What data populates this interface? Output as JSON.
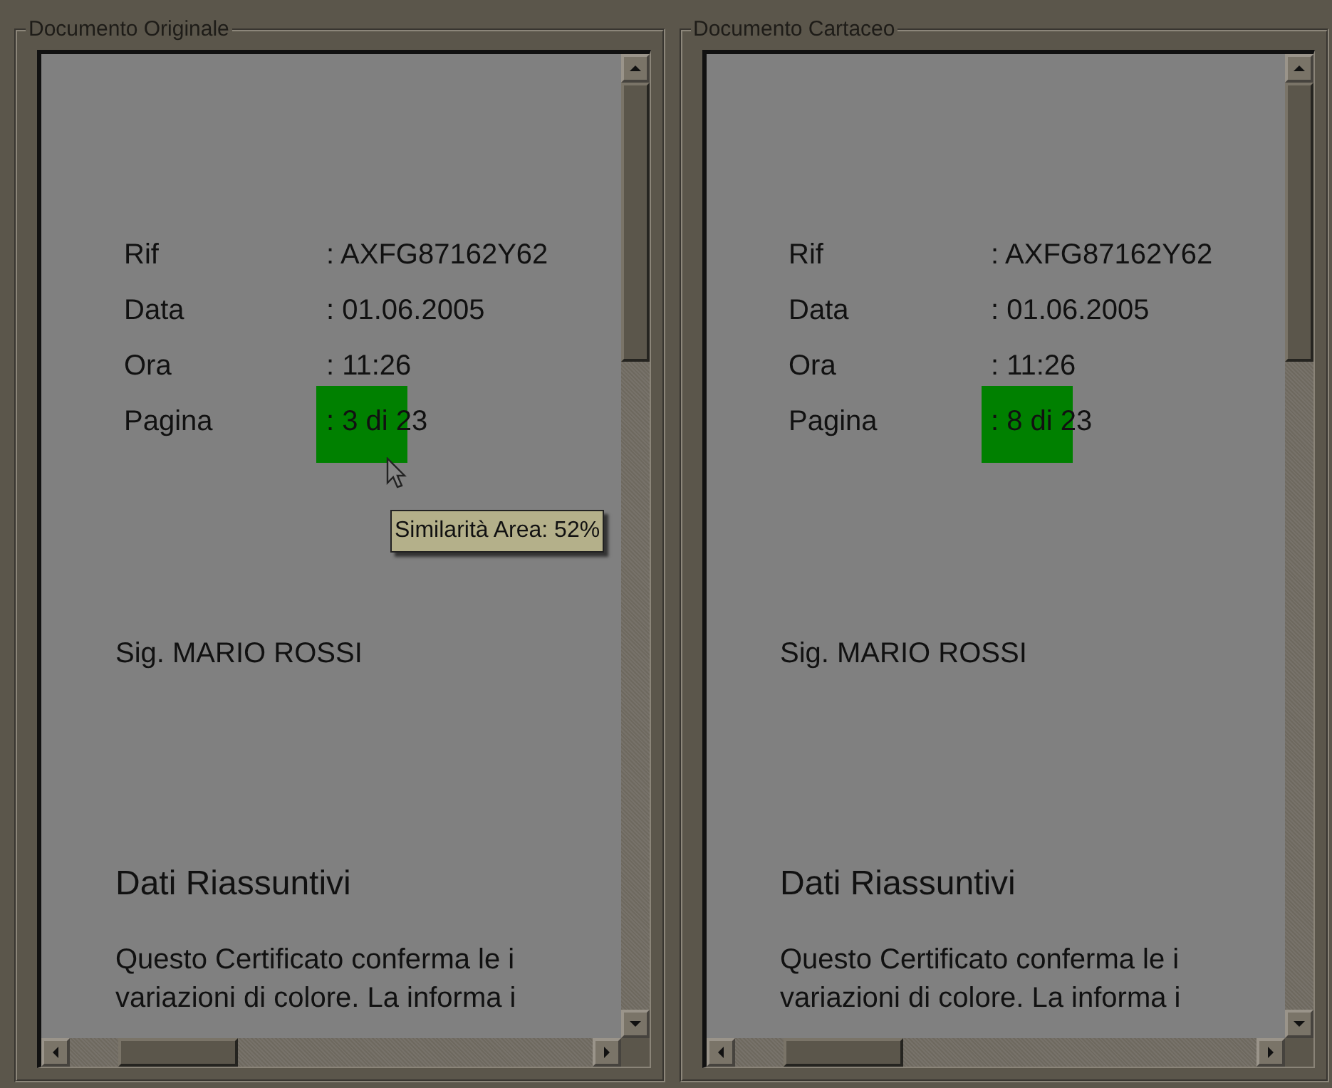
{
  "panels": [
    {
      "title": "Documento Originale",
      "fields": [
        {
          "label": "Rif",
          "value": ": AXFG87162Y62",
          "highlighted": false
        },
        {
          "label": "Data",
          "value": ": 01.06.2005",
          "highlighted": false
        },
        {
          "label": "Ora",
          "value": ": 11:26",
          "highlighted": false
        },
        {
          "label": "Pagina",
          "value": ": 3 di 23",
          "highlighted": true
        }
      ],
      "tooltip": "Similarità Area: 52%",
      "recipient": "Sig. MARIO ROSSI",
      "heading": "Dati Riassuntivi",
      "paragraph_lines": [
        "Questo Certificato conferma le i",
        "variazioni di colore. La informa i"
      ]
    },
    {
      "title": "Documento Cartaceo",
      "fields": [
        {
          "label": "Rif",
          "value": ": AXFG87162Y62",
          "highlighted": false
        },
        {
          "label": "Data",
          "value": ": 01.06.2005",
          "highlighted": false
        },
        {
          "label": "Ora",
          "value": ": 11:26",
          "highlighted": false
        },
        {
          "label": "Pagina",
          "value": ": 8 di 23",
          "highlighted": true
        }
      ],
      "recipient": "Sig. MARIO ROSSI",
      "heading": "Dati Riassuntivi",
      "paragraph_lines": [
        "Questo Certificato conferma le i",
        "variazioni di colore. La informa i"
      ]
    }
  ]
}
